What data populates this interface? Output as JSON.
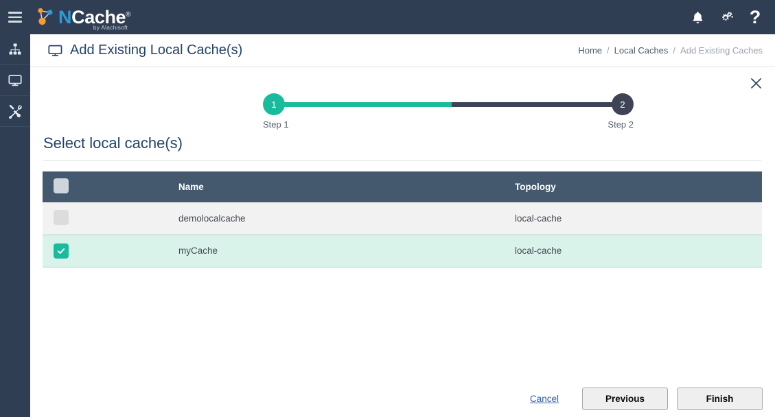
{
  "brand": {
    "logo_text_n": "N",
    "logo_text_rest": "Cache",
    "logo_registered": "®",
    "logo_subtitle": "by Alachisoft"
  },
  "topbar": {
    "menu_icon": "hamburger-icon",
    "icons": [
      {
        "name": "notifications-icon",
        "glyph": "bell"
      },
      {
        "name": "settings-gears-icon",
        "glyph": "gears"
      },
      {
        "name": "help-icon",
        "glyph": "?"
      }
    ]
  },
  "sidebar": {
    "items": [
      {
        "name": "sidebar-item-cluster",
        "icon": "sitemap-icon"
      },
      {
        "name": "sidebar-item-monitor",
        "icon": "monitor-icon"
      },
      {
        "name": "sidebar-item-tools",
        "icon": "tools-icon"
      }
    ]
  },
  "page": {
    "title": "Add Existing Local Cache(s)",
    "title_icon": "monitor-icon",
    "breadcrumb": [
      {
        "label": "Home",
        "current": false
      },
      {
        "label": "Local Caches",
        "current": false
      },
      {
        "label": "Add Existing Caches",
        "current": true
      }
    ],
    "breadcrumb_separator": "/",
    "close_label": "✕"
  },
  "wizard": {
    "steps": [
      {
        "number": "1",
        "label": "Step 1",
        "state": "active"
      },
      {
        "number": "2",
        "label": "Step 2",
        "state": "inactive"
      }
    ],
    "progress_percent": 51,
    "active_color": "#18bc9c",
    "inactive_color": "#3e4455"
  },
  "section": {
    "heading": "Select local cache(s)"
  },
  "table": {
    "select_all_checked": false,
    "columns": [
      {
        "key": "checkbox",
        "label": ""
      },
      {
        "key": "name",
        "label": "Name"
      },
      {
        "key": "topology",
        "label": "Topology"
      }
    ],
    "rows": [
      {
        "checked": false,
        "name": "demolocalcache",
        "topology": "local-cache"
      },
      {
        "checked": true,
        "name": "myCache",
        "topology": "local-cache"
      }
    ]
  },
  "footer": {
    "cancel_label": "Cancel",
    "previous_label": "Previous",
    "finish_label": "Finish"
  },
  "colors": {
    "header_bg": "#2f3e53",
    "table_header_bg": "#44586e",
    "accent_teal": "#18bc9c",
    "selected_row_bg": "#d9f2ea",
    "plain_row_bg": "#f2f2f2",
    "title_blue": "#22436c",
    "link_blue": "#2a5db0"
  }
}
